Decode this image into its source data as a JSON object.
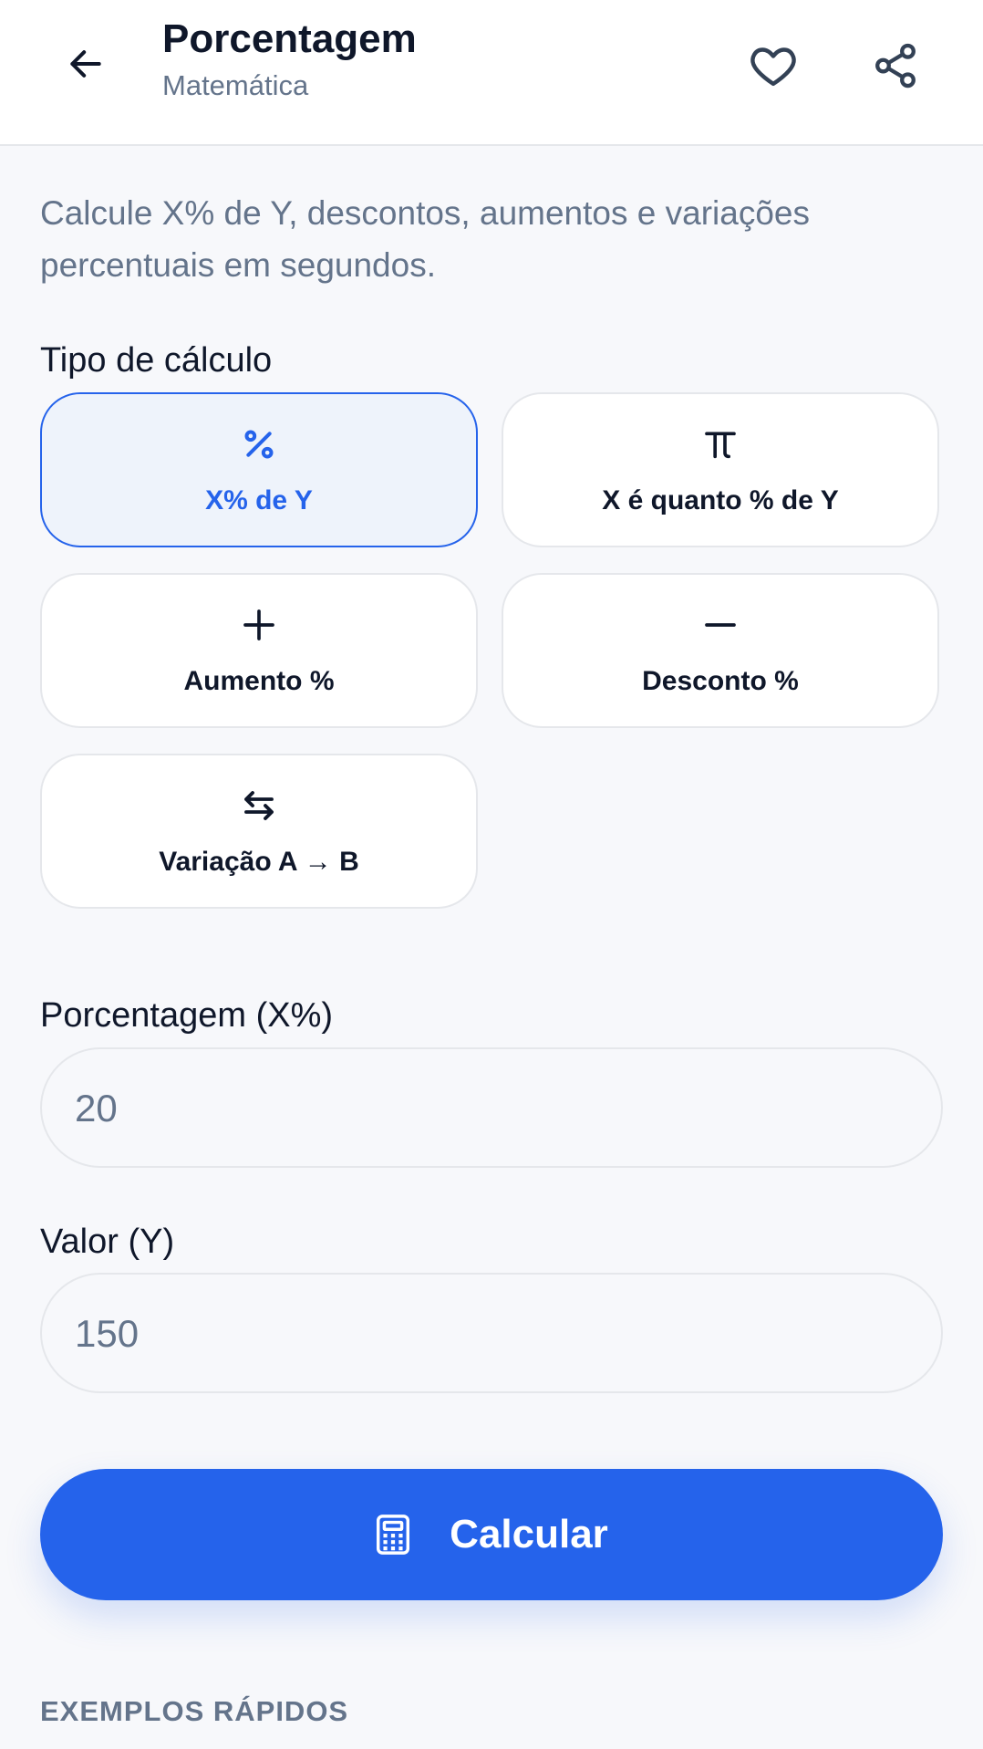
{
  "header": {
    "title": "Porcentagem",
    "subtitle": "Matemática",
    "icons": {
      "back": "arrow-left-icon",
      "favorite": "heart-icon",
      "share": "share-icon"
    }
  },
  "description": "Calcule X% de Y, descontos, aumentos e variações percentuais em segundos.",
  "calc_type": {
    "label": "Tipo de cálculo",
    "options": [
      {
        "label": "X% de Y",
        "icon": "percent-icon",
        "selected": true
      },
      {
        "label": "X é quanto % de Y",
        "icon": "pi-icon",
        "selected": false
      },
      {
        "label": "Aumento %",
        "icon": "plus-icon",
        "selected": false
      },
      {
        "label": "Desconto %",
        "icon": "minus-icon",
        "selected": false
      },
      {
        "label": "Variação A → B",
        "icon": "swap-arrows-icon",
        "selected": false
      }
    ]
  },
  "fields": {
    "percentage": {
      "label": "Porcentagem (X%)",
      "value": "",
      "placeholder": "20"
    },
    "value": {
      "label": "Valor (Y)",
      "value": "",
      "placeholder": "150"
    }
  },
  "calculate_button": {
    "label": "Calcular",
    "icon": "calculator-icon"
  },
  "quick_examples_heading": "EXEMPLOS RÁPIDOS",
  "colors": {
    "accent": "#2563eb",
    "background": "#f7f8fb",
    "text": "#0f172a",
    "muted": "#64748b",
    "selected_bg": "#eef3fb"
  }
}
